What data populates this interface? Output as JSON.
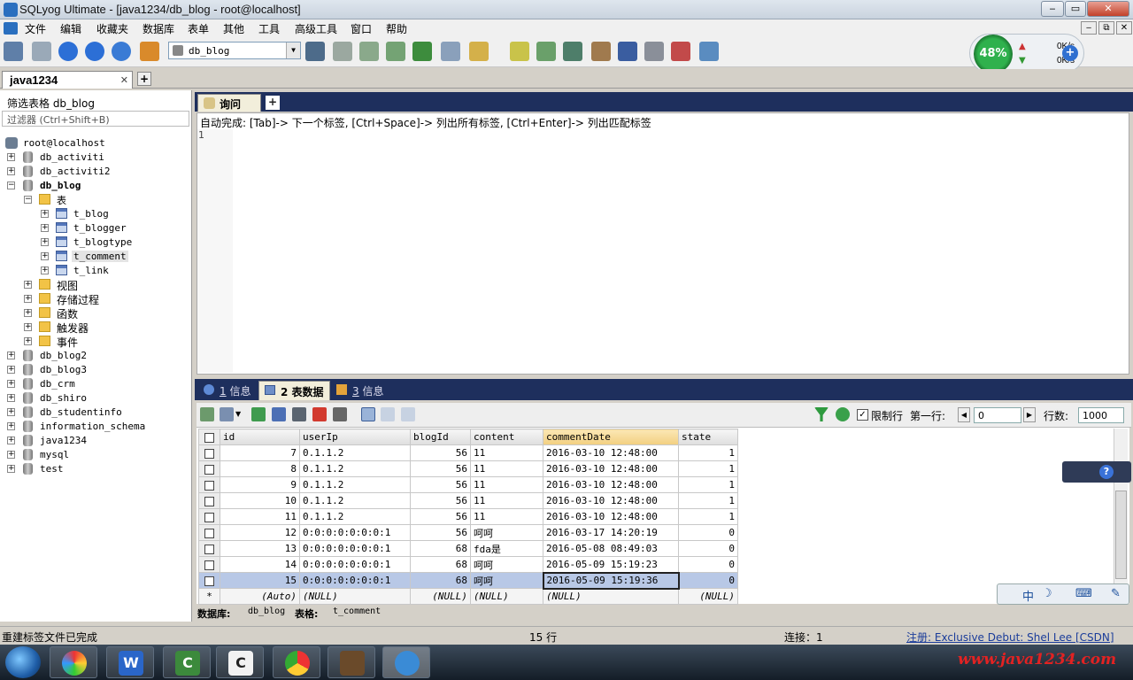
{
  "window": {
    "title": "SQLyog Ultimate - [java1234/db_blog - root@localhost]"
  },
  "menu": [
    "文件",
    "编辑",
    "收藏夹",
    "数据库",
    "表单",
    "其他",
    "工具",
    "高级工具",
    "窗口",
    "帮助"
  ],
  "toolbar": {
    "database_select": "db_blog"
  },
  "network": {
    "percent": "48%",
    "up": "0K/s",
    "down": "0K/s"
  },
  "connection_tab": {
    "label": "java1234",
    "close": "✕",
    "add": "+"
  },
  "left": {
    "filter_label": "筛选表格 db_blog",
    "filter_placeholder": "过滤器 (Ctrl+Shift+B)",
    "tree": {
      "root": "root@localhost",
      "dbs_before": [
        "db_activiti",
        "db_activiti2"
      ],
      "open_db": "db_blog",
      "tables_folder": "表",
      "tables": [
        "t_blog",
        "t_blogger",
        "t_blogtype",
        "t_comment",
        "t_link"
      ],
      "folders": [
        "视图",
        "存储过程",
        "函数",
        "触发器",
        "事件"
      ],
      "dbs_after": [
        "db_blog2",
        "db_blog3",
        "db_crm",
        "db_shiro",
        "db_studentinfo",
        "information_schema",
        "java1234",
        "mysql",
        "test"
      ]
    }
  },
  "query": {
    "tab_label": "询问",
    "hint": "自动完成: [Tab]-> 下一个标签, [Ctrl+Space]-> 列出所有标签, [Ctrl+Enter]-> 列出匹配标签",
    "line": "1"
  },
  "result_tabs": [
    {
      "num": "1",
      "label": "信息"
    },
    {
      "num": "2",
      "label": "表数据"
    },
    {
      "num": "3",
      "label": "信息"
    }
  ],
  "result_toolbar": {
    "limit_label": "限制行",
    "first_row_label": "第一行:",
    "first_row": "0",
    "rows_label": "行数:",
    "rows": "1000",
    "check": "✓"
  },
  "grid": {
    "columns": [
      "id",
      "userIp",
      "blogId",
      "content",
      "commentDate",
      "state"
    ],
    "rows": [
      [
        "7",
        "0.1.1.2",
        "56",
        "11",
        "2016-03-10 12:48:00",
        "1"
      ],
      [
        "8",
        "0.1.1.2",
        "56",
        "11",
        "2016-03-10 12:48:00",
        "1"
      ],
      [
        "9",
        "0.1.1.2",
        "56",
        "11",
        "2016-03-10 12:48:00",
        "1"
      ],
      [
        "10",
        "0.1.1.2",
        "56",
        "11",
        "2016-03-10 12:48:00",
        "1"
      ],
      [
        "11",
        "0.1.1.2",
        "56",
        "11",
        "2016-03-10 12:48:00",
        "1"
      ],
      [
        "12",
        "0:0:0:0:0:0:0:1",
        "56",
        "呵呵",
        "2016-03-17 14:20:19",
        "0"
      ],
      [
        "13",
        "0:0:0:0:0:0:0:1",
        "68",
        "fda是",
        "2016-05-08 08:49:03",
        "0"
      ],
      [
        "14",
        "0:0:0:0:0:0:0:1",
        "68",
        "呵呵",
        "2016-05-09 15:19:23",
        "0"
      ],
      [
        "15",
        "0:0:0:0:0:0:0:1",
        "68",
        "呵呵",
        "2016-05-09 15:19:36",
        "0"
      ]
    ],
    "new_row": {
      "marker": "*",
      "id": "(Auto)",
      "userIp": "(NULL)",
      "blogId": "(NULL)",
      "content": "(NULL)",
      "commentDate": "(NULL)",
      "state": "(NULL)"
    }
  },
  "infobar": {
    "db_label": "数据库:",
    "db": "db_blog",
    "table_label": "表格:",
    "table": "t_comment"
  },
  "status": {
    "left": "重建标签文件已完成",
    "rows": "15 行",
    "conn": "连接：1",
    "reg": "注册:  Exclusive Debut: Shel Lee [CSDN]"
  },
  "taskbar": {
    "watermark": "www.java1234.com"
  },
  "colors": {
    "accent": "#1e2f5d",
    "selection": "#b8c8e6",
    "watermark": "#e32222"
  }
}
